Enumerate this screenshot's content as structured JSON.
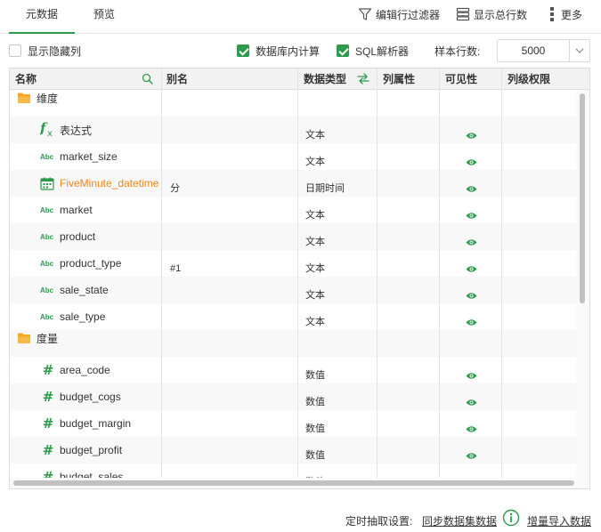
{
  "tabs": [
    {
      "label": "元数据",
      "active": true
    },
    {
      "label": "预览",
      "active": false
    }
  ],
  "toolbar": {
    "filter_label": "编辑行过滤器",
    "total_label": "显示总行数",
    "more_label": "更多"
  },
  "options": {
    "show_hidden_label": "显示隐藏列",
    "show_hidden_checked": false,
    "db_compute_label": "数据库内计算",
    "db_compute_checked": true,
    "sql_parser_label": "SQL解析器",
    "sql_parser_checked": true,
    "sample_rows_label": "样本行数:",
    "sample_rows_value": "5000"
  },
  "table": {
    "headers": {
      "name": "名称",
      "alias": "别名",
      "type": "数据类型",
      "attr": "列属性",
      "visible": "可见性",
      "perm": "列级权限"
    },
    "groups": [
      {
        "label": "维度",
        "icon": "folder-icon",
        "fields": [
          {
            "name": "表达式",
            "icon": "fx-icon",
            "alias": "",
            "type": "文本",
            "visible": true,
            "highlight": false
          },
          {
            "name": "market_size",
            "icon": "abc-icon",
            "alias": "",
            "type": "文本",
            "visible": true,
            "highlight": false
          },
          {
            "name": "FiveMinute_datetime",
            "icon": "calendar-icon",
            "alias": "分",
            "type": "日期时间",
            "visible": true,
            "highlight": true
          },
          {
            "name": "market",
            "icon": "abc-icon",
            "alias": "",
            "type": "文本",
            "visible": true,
            "highlight": false
          },
          {
            "name": "product",
            "icon": "abc-icon",
            "alias": "",
            "type": "文本",
            "visible": true,
            "highlight": false
          },
          {
            "name": "product_type",
            "icon": "abc-icon",
            "alias": "#1",
            "type": "文本",
            "visible": true,
            "highlight": false
          },
          {
            "name": "sale_state",
            "icon": "abc-icon",
            "alias": "",
            "type": "文本",
            "visible": true,
            "highlight": false
          },
          {
            "name": "sale_type",
            "icon": "abc-icon",
            "alias": "",
            "type": "文本",
            "visible": true,
            "highlight": false
          }
        ]
      },
      {
        "label": "度量",
        "icon": "folder-icon",
        "fields": [
          {
            "name": "area_code",
            "icon": "hash-icon",
            "alias": "",
            "type": "数值",
            "visible": true,
            "highlight": false
          },
          {
            "name": "budget_cogs",
            "icon": "hash-icon",
            "alias": "",
            "type": "数值",
            "visible": true,
            "highlight": false
          },
          {
            "name": "budget_margin",
            "icon": "hash-icon",
            "alias": "",
            "type": "数值",
            "visible": true,
            "highlight": false
          },
          {
            "name": "budget_profit",
            "icon": "hash-icon",
            "alias": "",
            "type": "数值",
            "visible": true,
            "highlight": false
          },
          {
            "name": "budget_sales",
            "icon": "hash-icon",
            "alias": "",
            "type": "数值",
            "visible": true,
            "highlight": false
          }
        ]
      }
    ]
  },
  "footer": {
    "label": "定时抽取设置:",
    "sync_link": "同步数据集数据",
    "incremental_link": "增量导入数据"
  },
  "colors": {
    "accent": "#2e9a4b",
    "highlight": "#e8871e",
    "folder": "#f5a623"
  }
}
